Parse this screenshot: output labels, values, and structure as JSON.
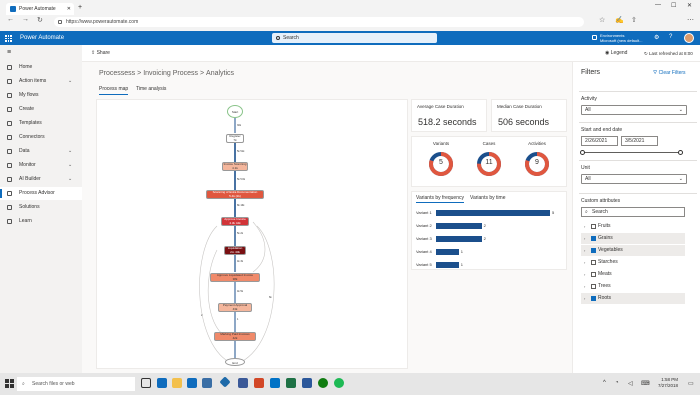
{
  "browser": {
    "tab_title": "Power Automate",
    "url": "https://www.powerautomate.com"
  },
  "topbar": {
    "app_title": "Power Automate",
    "search_placeholder": "Search",
    "env_label": "Environments",
    "env_name": "Microsoft (new default..."
  },
  "sidebar": {
    "items": [
      {
        "label": "Home"
      },
      {
        "label": "Action items",
        "chevron": true
      },
      {
        "label": "My flows"
      },
      {
        "label": "Create"
      },
      {
        "label": "Templates"
      },
      {
        "label": "Connectors"
      },
      {
        "label": "Data",
        "chevron": true
      },
      {
        "label": "Monitor",
        "chevron": true
      },
      {
        "label": "AI Builder",
        "chevron": true
      },
      {
        "label": "Process Advisor",
        "selected": true
      },
      {
        "label": "Solutions"
      },
      {
        "label": "Learn"
      }
    ]
  },
  "cmdbar": {
    "share": "Share",
    "legend": "Legend",
    "last_refreshed": "Last refreshed at 8:00 AM"
  },
  "main": {
    "crumbs": [
      "Processess",
      ">",
      "Invoicing Process",
      ">",
      "Analytics"
    ],
    "tabs": [
      "Process map",
      "Time analysis"
    ]
  },
  "process_map": {
    "start": "Start",
    "end": "End",
    "nodes": [
      {
        "label": "Register",
        "value": "7k",
        "color": "#ffffff"
      },
      {
        "label": "Invoice Scanning",
        "value": "4.1k",
        "color": "#f4b69c"
      },
      {
        "label": "Scanning of Extra Documentation",
        "value": "5.4k (2k)",
        "color": "#e0573f"
      },
      {
        "label": "Approve Invoice",
        "value": "4.3k 44k",
        "color": "#d13438"
      },
      {
        "label": "Liquidation",
        "value": "2m 40k",
        "color": "#7a1012"
      },
      {
        "label": "Approve Liquidated Invoice",
        "value": "38k",
        "color": "#f08a6a"
      },
      {
        "label": "Payment Approval",
        "value": "43k",
        "color": "#f4b69c"
      },
      {
        "label": "Marking Paid Invoices",
        "value": "42k",
        "color": "#f08a6a"
      }
    ],
    "edge_labels": [
      "30k",
      "5k 51k",
      "5k 5.6k",
      "8k 16k",
      "5k 2k",
      "4k 3k",
      "4k 5k",
      "1",
      "2",
      "6k"
    ]
  },
  "stats": {
    "avg_label": "Average Case Duration",
    "avg_value": "518.2 seconds",
    "median_label": "Median Case Duration",
    "median_value": "506 seconds"
  },
  "donuts": [
    {
      "label": "Variants",
      "value": "5",
      "fill": 0.8
    },
    {
      "label": "Cases",
      "value": "11",
      "fill": 0.75
    },
    {
      "label": "Activities",
      "value": "9",
      "fill": 0.8
    }
  ],
  "variants": {
    "tab_freq": "Variants by frequency",
    "tab_time": "Variants by time"
  },
  "chart_data": {
    "type": "bar",
    "categories": [
      "Variant 1",
      "Variant 2",
      "Variant 3",
      "Variant 4",
      "Variant 5"
    ],
    "values": [
      5,
      2,
      2,
      1,
      1
    ],
    "xlim": [
      0,
      5
    ],
    "orientation": "horizontal",
    "color": "#1b4f8c"
  },
  "filters": {
    "title": "Filters",
    "clear": "Clear Filters",
    "activity_label": "Activity",
    "activity_value": "All",
    "date_label": "Start and end date",
    "date_start": "2/26/2021",
    "date_end": "3/5/2021",
    "unit_label": "Unit",
    "unit_value": "All",
    "custom_label": "Custom attributes",
    "attr_search": "Search",
    "attributes": [
      {
        "label": "Fruits",
        "checked": false
      },
      {
        "label": "Grains",
        "checked": true
      },
      {
        "label": "Vegetables",
        "checked": true
      },
      {
        "label": "Starches",
        "checked": false
      },
      {
        "label": "Meats",
        "checked": false
      },
      {
        "label": "Trees",
        "checked": false
      },
      {
        "label": "Roots",
        "checked": true
      }
    ]
  },
  "taskbar": {
    "search": "Search files or web",
    "time": "1:58 PM",
    "date": "7/27/2018"
  },
  "colors": {
    "accent": "#0f6cbd",
    "bar": "#1b4f8c",
    "donut": "#e0573f",
    "donut_bg": "#1b4f8c"
  }
}
